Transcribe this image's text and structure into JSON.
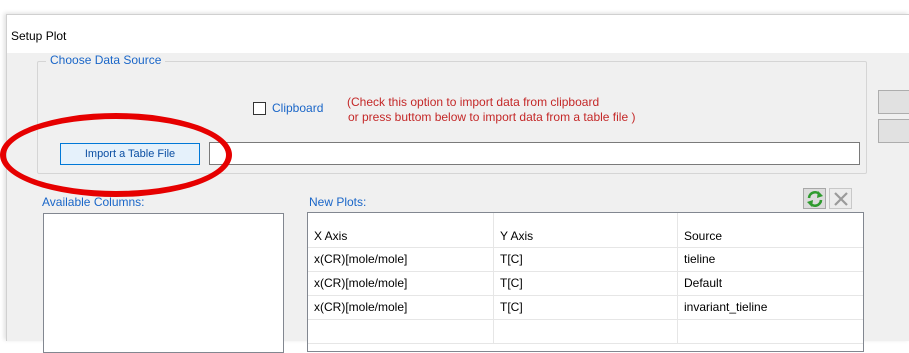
{
  "window": {
    "title": "Setup Plot"
  },
  "data_source": {
    "group_label": "Choose Data Source",
    "clipboard": {
      "label": "Clipboard",
      "checked": false
    },
    "hint_line1": "(Check this option to import data from clipboard",
    "hint_line2": "or press buttom below to import data from a table file )",
    "import_button_label": "Import a Table File",
    "file_path_value": ""
  },
  "available_columns": {
    "label": "Available Columns:",
    "items": []
  },
  "new_plots": {
    "label": "New Plots:",
    "columns": [
      "X Axis",
      "Y Axis",
      "Source"
    ],
    "rows": [
      [
        "x(CR)[mole/mole]",
        "T[C]",
        "tieline"
      ],
      [
        "x(CR)[mole/mole]",
        "T[C]",
        "Default"
      ],
      [
        "x(CR)[mole/mole]",
        "T[C]",
        "invariant_tieline"
      ]
    ]
  },
  "icons": {
    "refresh": "green-refresh-arrows-icon",
    "delete": "gray-x-icon"
  },
  "colors": {
    "accent_blue": "#1a66c8",
    "hint_red": "#c42828",
    "highlight_red": "#e60000"
  }
}
